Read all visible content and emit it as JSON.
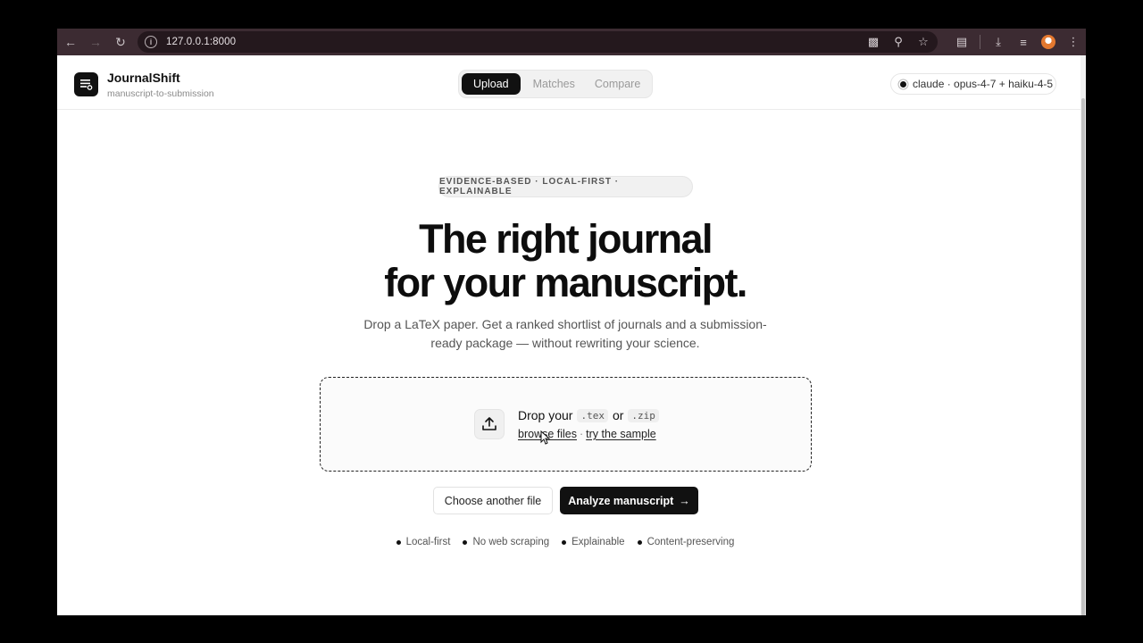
{
  "browser": {
    "url": "127.0.0.1:8000",
    "icons": [
      "back-icon",
      "forward-icon",
      "reload-icon",
      "site-info-icon",
      "translate-icon",
      "zoom-icon",
      "bookmark-star-icon",
      "extensions-icon",
      "download-icon",
      "media-controls-icon",
      "profile-avatar",
      "menu-kebab-icon"
    ]
  },
  "header": {
    "brand_title": "JournalShift",
    "brand_subtitle": "manuscript-to-submission",
    "tabs": [
      {
        "label": "Upload",
        "active": true
      },
      {
        "label": "Matches",
        "active": false
      },
      {
        "label": "Compare",
        "active": false
      }
    ],
    "model_label": "claude · opus-4-7 + haiku-4-5"
  },
  "main": {
    "badge": "EVIDENCE-BASED · LOCAL-FIRST · EXPLAINABLE",
    "hero_line1": "The right journal",
    "hero_line2": "for your manuscript.",
    "lede_line1": "Drop a LaTeX paper. Get a ranked shortlist of journals and a submission-",
    "lede_line2": "ready package — without rewriting your science.",
    "dropzone": {
      "prefix": "Drop your",
      "ext1": ".tex",
      "joiner": "or",
      "ext2": ".zip",
      "browse_label": "browse files",
      "separator": "·",
      "sample_label": "try the sample"
    },
    "choose_another_label": "Choose another file",
    "analyze_label": "Analyze manuscript",
    "features": [
      "Local-first",
      "No web scraping",
      "Explainable",
      "Content-preserving"
    ]
  },
  "colors": {
    "primary": "#111111",
    "browser_bar": "#3c2b32",
    "muted_text": "#555555"
  }
}
